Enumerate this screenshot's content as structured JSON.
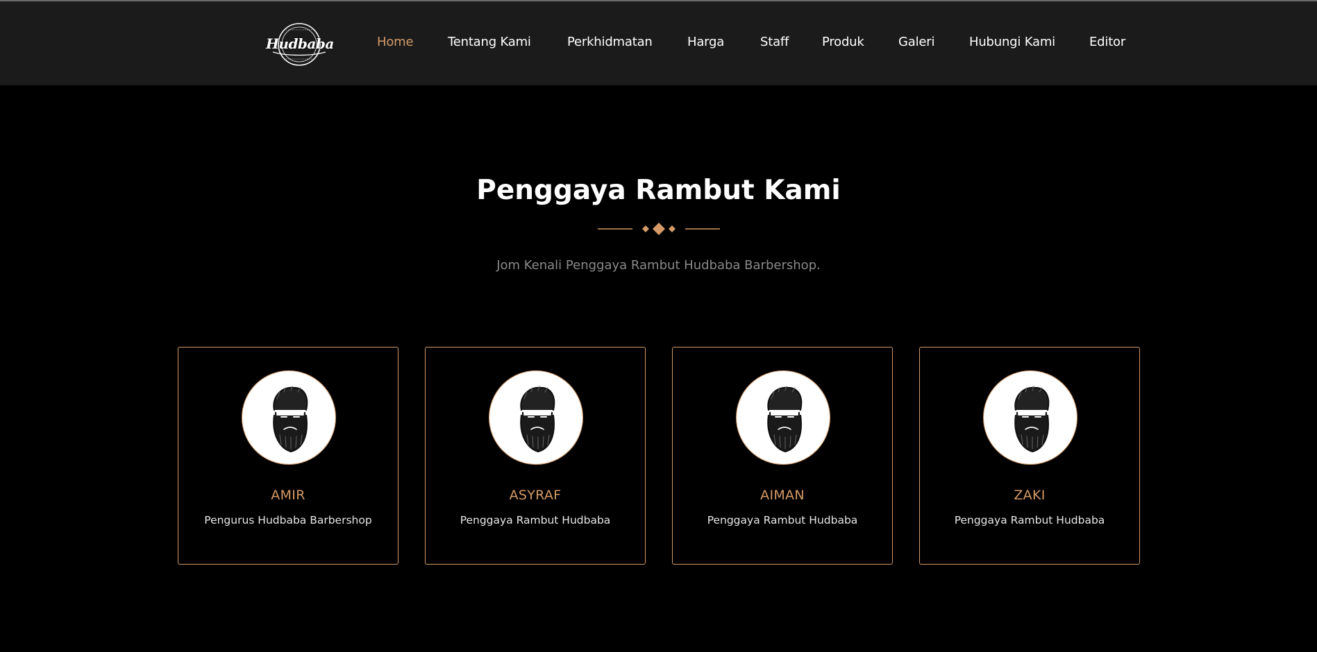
{
  "brand": {
    "logo_text": "Hudbaba",
    "accent_color": "#d49a68",
    "nav_bg": "#1b1b1b"
  },
  "nav": {
    "items": [
      {
        "label": "Home",
        "active": true
      },
      {
        "label": "Tentang Kami",
        "active": false
      },
      {
        "label": "Perkhidmatan",
        "active": false
      },
      {
        "label": "Harga",
        "active": false
      },
      {
        "label": "Staff",
        "active": false
      },
      {
        "label": "Produk",
        "active": false
      },
      {
        "label": "Galeri",
        "active": false
      },
      {
        "label": "Hubungi Kami",
        "active": false
      },
      {
        "label": "Editor",
        "active": false
      }
    ]
  },
  "section": {
    "title": "Penggaya Rambut Kami",
    "subtitle": "Jom Kenali Penggaya Rambut Hudbaba Barbershop."
  },
  "team": [
    {
      "name": "AMIR",
      "role": "Pengurus Hudbaba Barbershop",
      "avatar_icon": "bearded-man-icon"
    },
    {
      "name": "ASYRAF",
      "role": "Penggaya Rambut Hudbaba",
      "avatar_icon": "bearded-man-icon"
    },
    {
      "name": "AIMAN",
      "role": "Penggaya Rambut Hudbaba",
      "avatar_icon": "bearded-man-icon"
    },
    {
      "name": "ZAKI",
      "role": "Penggaya Rambut Hudbaba",
      "avatar_icon": "bearded-man-icon"
    }
  ]
}
